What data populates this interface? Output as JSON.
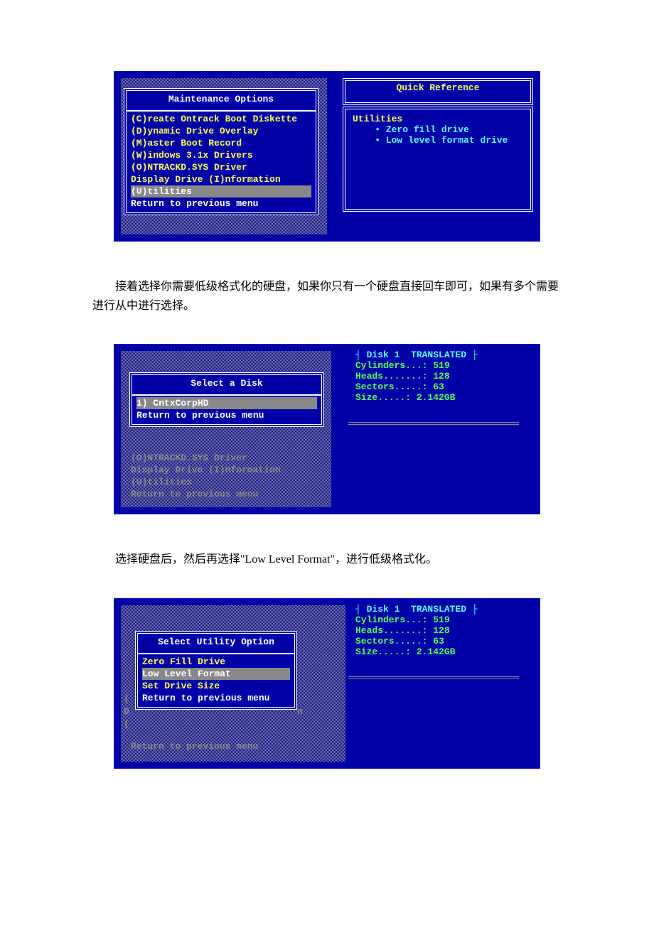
{
  "screen1": {
    "menu_title": "Maintenance Options",
    "items": [
      "(C)reate Ontrack Boot Diskette",
      "(D)ynamic Drive Overlay",
      "(M)aster Boot Record",
      "(W)indows 3.1x Drivers",
      "(O)NTRACKD.SYS Driver",
      "Display Drive (I)nformation",
      "(U)tilities",
      "Return to previous menu"
    ],
    "selected_index": 6,
    "ref_title": "Quick Reference",
    "ref_heading": "Utilities",
    "ref_items": [
      "• Zero fill drive",
      "• Low level format drive"
    ]
  },
  "para1": "接着选择你需要低级格式化的硬盘，如果你只有一个硬盘直接回车即可，如果有多个需要进行从中进行选择。",
  "screen2": {
    "menu_title": "Select a Disk",
    "items": [
      "1) CntxCorpHD",
      "Return to previous menu"
    ],
    "selected_index": 0,
    "under_items": [
      "(O)NTRACKD.SYS Driver",
      "Display Drive (I)nformation",
      "(U)tilities",
      "Return to previous menu"
    ],
    "info_title": "┤ Disk 1  TRANSLATED ├",
    "info_lines": [
      "Cylinders...: 519",
      "Heads.......: 128",
      "Sectors.....: 63",
      "Size.....: 2.142GB"
    ]
  },
  "para2": "选择硬盘后，然后再选择\"Low Level Format\"，进行低级格式化。",
  "screen3": {
    "menu_title": "Select Utility Option",
    "items": [
      "Zero Fill Drive",
      "Low Level Format",
      "Set Drive Size",
      "Return to previous menu"
    ],
    "selected_index": 1,
    "under_items": [
      "Return to previous menu"
    ],
    "edge_letters": [
      "(",
      "D",
      "("
    ],
    "edge_right": "n",
    "info_title": "┤ Disk 1  TRANSLATED ├",
    "info_lines": [
      "Cylinders...: 519",
      "Heads.......: 128",
      "Sectors.....: 63",
      "Size.....: 2.142GB"
    ]
  }
}
